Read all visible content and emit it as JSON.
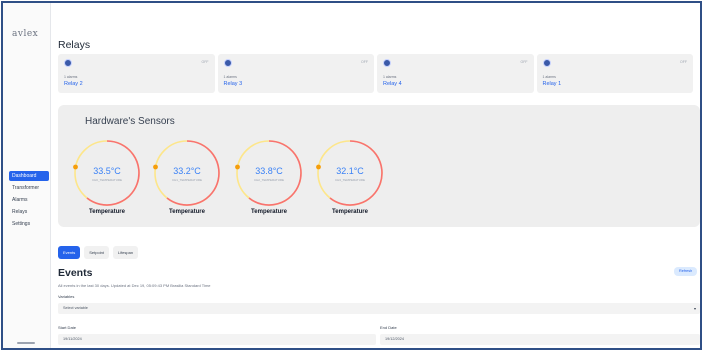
{
  "app": {
    "logo": "avlex"
  },
  "sidebar": {
    "items": [
      {
        "label": "Dashboard",
        "active": true
      },
      {
        "label": "Transformer",
        "active": false
      },
      {
        "label": "Alarms",
        "active": false
      },
      {
        "label": "Relays",
        "active": false
      },
      {
        "label": "Settings",
        "active": false
      }
    ]
  },
  "relays": {
    "title": "Relays",
    "cards": [
      {
        "name": "Relay 2",
        "alarms": "1 alarms",
        "status": "OFF"
      },
      {
        "name": "Relay 3",
        "alarms": "1 alarms",
        "status": "OFF"
      },
      {
        "name": "Relay 4",
        "alarms": "1 alarms",
        "status": "OFF"
      },
      {
        "name": "Relay 1",
        "alarms": "1 alarms",
        "status": "OFF"
      }
    ]
  },
  "sensors": {
    "title": "Hardware's Sensors",
    "items": [
      {
        "value": "33.5°C",
        "code": "CH0_TEMPERATURE",
        "label": "Temperature"
      },
      {
        "value": "33.2°C",
        "code": "CH1_TEMPERATURE",
        "label": "Temperature"
      },
      {
        "value": "33.8°C",
        "code": "CH2_TEMPERATURE",
        "label": "Temperature"
      },
      {
        "value": "32.1°C",
        "code": "CH3_TEMPERATURE",
        "label": "Temperature"
      }
    ],
    "colors": {
      "gauge_hot": "#ef4444",
      "gauge_warm": "#f59e0b",
      "value": "#3b82f6"
    }
  },
  "tabs": [
    {
      "label": "Events",
      "active": true
    },
    {
      "label": "Setpoint",
      "active": false
    },
    {
      "label": "Lifespan",
      "active": false
    }
  ],
  "events": {
    "title": "Events",
    "description": "All events in the last 30 days. Updated at Dec 19, 05:09:43 PM Brasilia Standard Time",
    "refresh_label": "Refresh",
    "variables_label": "Variables",
    "variable_selected": "Select variable",
    "start_label": "Start Date",
    "start_value": "19/11/2024",
    "end_label": "End Date",
    "end_value": "19/12/2024"
  },
  "colors": {
    "accent": "#2563eb",
    "frame": "#2f4f86",
    "panel": "#eeeeee"
  }
}
